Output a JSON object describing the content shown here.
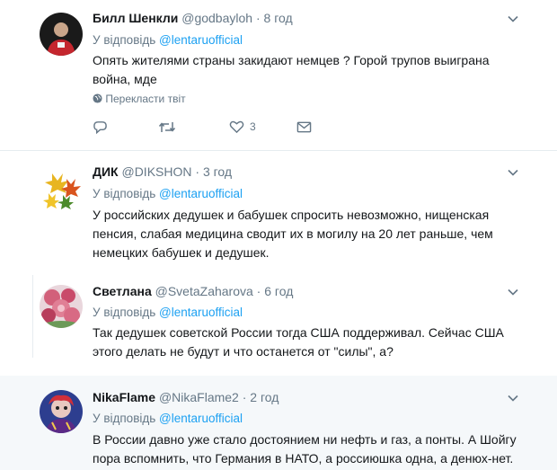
{
  "reply_prefix": "У відповідь",
  "tweets": [
    {
      "name": "Билл Шенкли",
      "handle": "@godbayloh",
      "time": "8 год",
      "reply_to": "@lentaruofficial",
      "text": "Опять жителями страны закидают немцев ? Горой трупов выиграна война, мде",
      "translate": "Перекласти твіт",
      "like_count": "3"
    },
    {
      "name": "ДИК",
      "handle": "@DIKSHON",
      "time": "3 год",
      "reply_to": "@lentaruofficial",
      "text": "У российских дедушек и бабушек спросить невозможно, нищенская пенсия, слабая медицина сводит их в могилу на 20 лет раньше, чем немецких бабушек и дедушек."
    },
    {
      "name": "Светлана",
      "handle": "@SvetaZaharova",
      "time": "6 год",
      "reply_to": "@lentaruofficial",
      "text": "Так дедушек советской России тогда США поддерживал. Сейчас США этого делать не будут и что останется от \"силы\", а?"
    },
    {
      "name": "NikaFlame",
      "handle": "@NikaFlame2",
      "time": "2 год",
      "reply_to": "@lentaruofficial",
      "text": "В России давно уже стало достоянием ни нефть и газ, а понты. А Шойгу пора вспомнить, что Германия в НАТО, а россиюшка одна, а денюх-нет."
    }
  ],
  "colors": {
    "link": "#1da1f2",
    "muted": "#657786",
    "text": "#14171a",
    "divider": "#e6ecf0"
  }
}
